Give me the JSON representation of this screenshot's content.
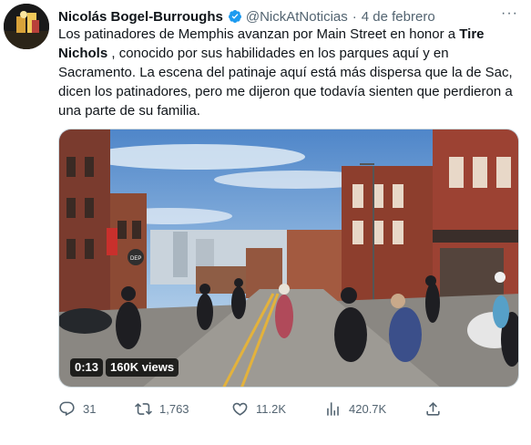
{
  "tweet": {
    "author_name": "Nicolás Bogel-Burroughs",
    "handle": "@NickAtNoticias",
    "separator": "·",
    "date": "4 de febrero",
    "more_label": "···",
    "text_part1": "Los patinadores de Memphis avanzan por Main Street en honor a ",
    "text_bold": "Tire Nichols",
    "text_part2": " , conocido por sus habilidades en los parques aquí y en Sacramento. La escena del patinaje aquí está más dispersa que la de Sac, dicen los patinadores, pero me dijeron que todavía sienten que perdieron a una parte de su familia."
  },
  "video": {
    "duration": "0:13",
    "views": "160K views",
    "sign_text": "DEP"
  },
  "actions": {
    "replies": "31",
    "retweets": "1,763",
    "likes": "11.2K",
    "views": "420.7K"
  },
  "icons": [
    "verified-badge-icon",
    "more-options-icon",
    "reply-icon",
    "retweet-icon",
    "like-icon",
    "views-icon",
    "share-icon"
  ],
  "colors": {
    "verified": "#1d9bf0",
    "secondary_text": "#536471",
    "text": "#0f1419"
  }
}
